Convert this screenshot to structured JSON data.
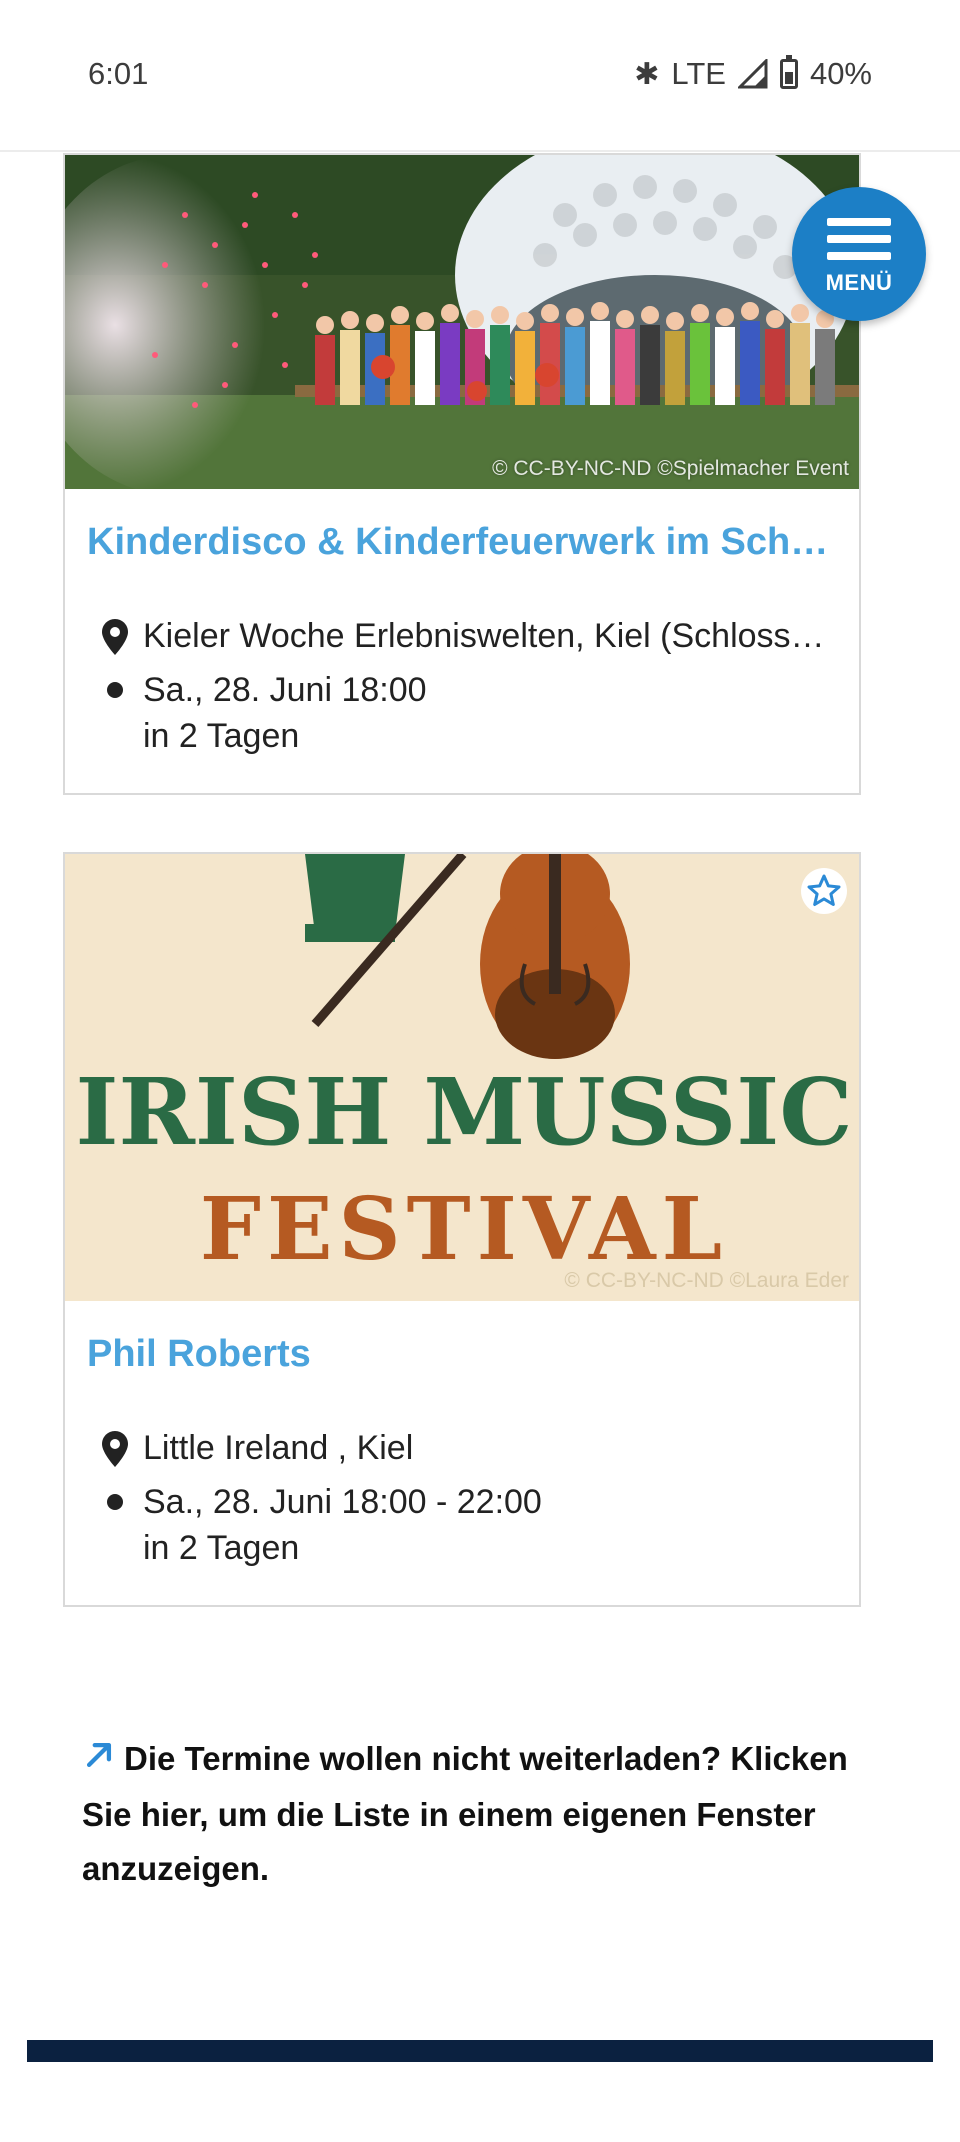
{
  "status_bar": {
    "time": "6:01",
    "network": "LTE",
    "battery": "40%",
    "icons": [
      "bluetooth-icon",
      "signal-icon",
      "battery-icon"
    ]
  },
  "menu_button": {
    "label": "MENÜ"
  },
  "events": [
    {
      "title": "Kinderdisco & Kinderfeuerwerk im Schlo…",
      "image_credit": "© CC-BY-NC-ND ©Spielmacher Event",
      "location": "Kieler Woche Erlebniswelten, Kiel (Schloss…",
      "date": "Sa., 28. Juni 18:00",
      "relative": "in 2 Tagen"
    },
    {
      "title": "Phil Roberts",
      "image_credit": "© CC-BY-NC-ND ©Laura Eder",
      "image_text_top": "IRISH MUSSIC",
      "image_text_bottom": "FESTIVAL",
      "location": "Little Ireland , Kiel",
      "date": "Sa., 28. Juni 18:00 - 22:00",
      "relative": "in 2 Tagen"
    }
  ],
  "hint": {
    "line": "Die Termine wollen nicht weiterladen? Klicken Sie hier, um die Liste in einem eigenen Fenster anzuzeigen."
  },
  "colors": {
    "accent": "#4aa3dc",
    "menu": "#1c7fc6",
    "footer": "#0b2140"
  }
}
